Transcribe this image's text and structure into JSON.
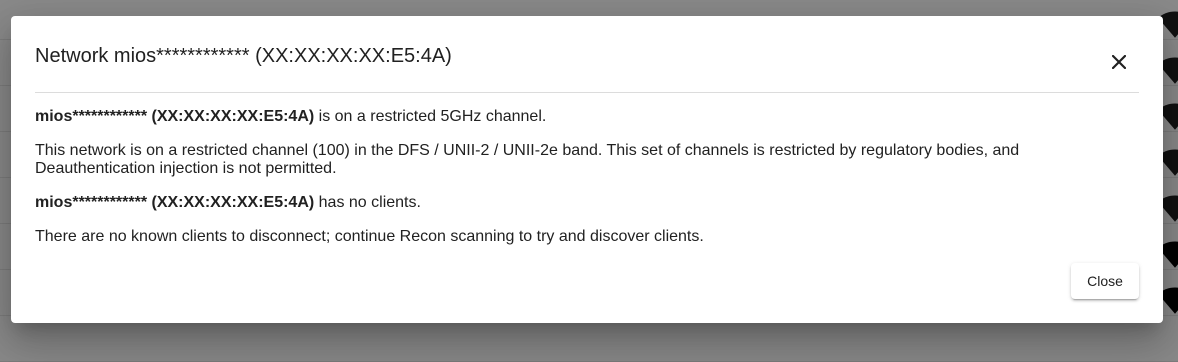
{
  "dialog": {
    "title": "Network mios************ (XX:XX:XX:XX:E5:4A)",
    "network_label": "mios************ (XX:XX:XX:XX:E5:4A)",
    "restricted_text": " is on a restricted 5GHz channel.",
    "restricted_detail": "This network is on a restricted channel (100) in the DFS / UNII-2 / UNII-2e band. This set of channels is restricted by regulatory bodies, and Deauthentication injection is not permitted.",
    "clients_text": " has no clients.",
    "clients_detail": "There are no known clients to disconnect; continue Recon scanning to try and discover clients.",
    "close_label": "Close",
    "close_icon": "close-icon"
  },
  "background": {
    "wifi_icon": "wifi-signal-icon"
  }
}
